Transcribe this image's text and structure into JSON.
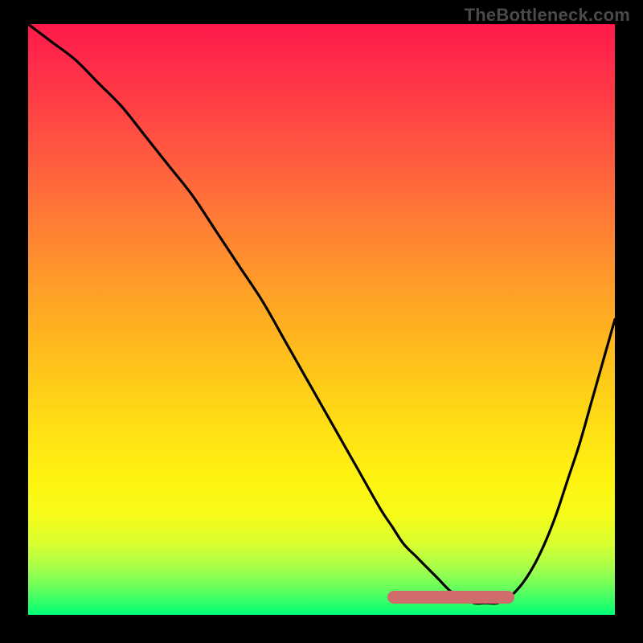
{
  "watermark": "TheBottleneck.com",
  "colors": {
    "background": "#000000",
    "curve": "#000000",
    "pink_marker": "#d16c6c",
    "gradient_top": "#ff1a4b",
    "gradient_bottom": "#00ff76",
    "watermark_text": "#4a4a4a"
  },
  "chart_data": {
    "type": "line",
    "title": "",
    "xlabel": "",
    "ylabel": "",
    "xlim": [
      0,
      100
    ],
    "ylim": [
      0,
      100
    ],
    "series": [
      {
        "name": "bottleneck-curve",
        "x": [
          0,
          4,
          8,
          12,
          16,
          20,
          24,
          28,
          32,
          36,
          40,
          44,
          48,
          52,
          56,
          60,
          62,
          64,
          66,
          68,
          70,
          72,
          74,
          76,
          78,
          80,
          82,
          84,
          86,
          88,
          90,
          92,
          94,
          96,
          98,
          100
        ],
        "values": [
          100,
          97,
          94,
          90,
          86,
          81,
          76,
          71,
          65,
          59,
          53,
          46,
          39,
          32,
          25,
          18,
          15,
          12,
          10,
          8,
          6,
          4,
          3,
          2,
          2,
          2,
          3,
          5,
          8,
          12,
          17,
          23,
          29,
          36,
          43,
          50
        ]
      }
    ],
    "marker": {
      "name": "highlight-region",
      "x_range": [
        62,
        82
      ],
      "y_value": 3
    },
    "gradient_background": {
      "direction": "top-to-bottom",
      "stops": [
        {
          "pos": 0,
          "color": "#ff1a4b"
        },
        {
          "pos": 50,
          "color": "#ffb81e"
        },
        {
          "pos": 80,
          "color": "#fff312"
        },
        {
          "pos": 100,
          "color": "#00ff76"
        }
      ]
    }
  }
}
